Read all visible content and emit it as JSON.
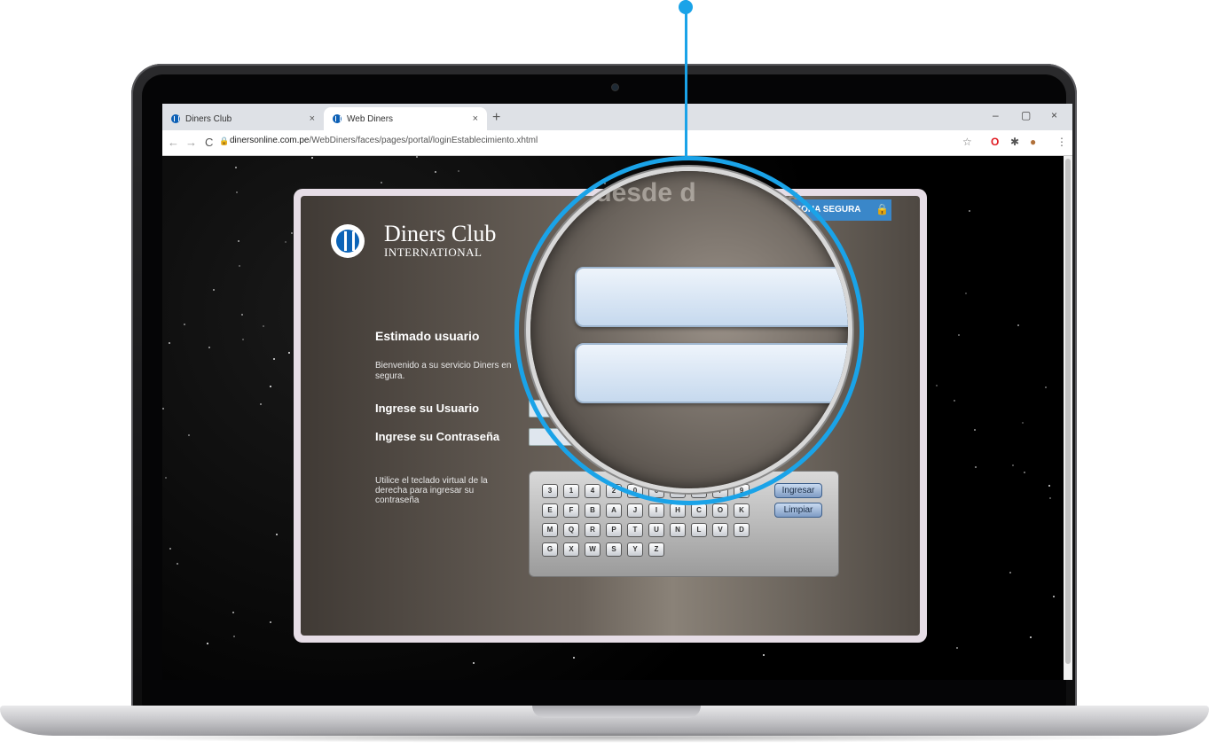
{
  "browser": {
    "tabs": [
      {
        "label": "Diners Club",
        "close": "×"
      },
      {
        "label": "Web Diners",
        "close": "×"
      }
    ],
    "new_tab": "+",
    "window_controls": {
      "minimize": "–",
      "restore": "▢",
      "close": "×"
    },
    "nav": {
      "back": "←",
      "forward": "→",
      "reload": "C"
    },
    "url_host": "dinersonline.com.pe",
    "url_path": "/WebDiners/faces/pages/portal/loginEstablecimiento.xhtml",
    "toolbar_icons": [
      "star-icon",
      "opera-icon",
      "extensions-icon",
      "profile-icon",
      "menu-icon"
    ]
  },
  "login": {
    "brand_name": "Diners Club",
    "brand_sub": "INTERNATIONAL",
    "secure_zone": "ZONA SEGURA",
    "tagline": "a, desde d",
    "heading": "Estimado usuario",
    "welcome": "Bienvenido a su servicio Diners en segura.",
    "user_label": "Ingrese su Usuario",
    "password_label": "Ingrese su Contraseña",
    "forgot_mark": "?",
    "keyboard_hint": "Utilice el teclado virtual de la derecha para ingresar su contraseña",
    "keyboard": {
      "row1": [
        "3",
        "1",
        "4",
        "2",
        "0",
        "6",
        "5",
        "8",
        "7",
        "9"
      ],
      "row2": [
        "E",
        "F",
        "B",
        "A",
        "J",
        "I",
        "H",
        "C",
        "O",
        "K"
      ],
      "row3": [
        "M",
        "Q",
        "R",
        "P",
        "T",
        "U",
        "N",
        "L",
        "V",
        "D"
      ],
      "row4": [
        "G",
        "X",
        "W",
        "S",
        "Y",
        "Z"
      ],
      "submit": "Ingresar",
      "clear": "Limpiar"
    }
  },
  "colors": {
    "accent": "#1aa3e8",
    "brand_blue": "#0b63b7",
    "secure_zone_bg": "#3a87c9"
  }
}
